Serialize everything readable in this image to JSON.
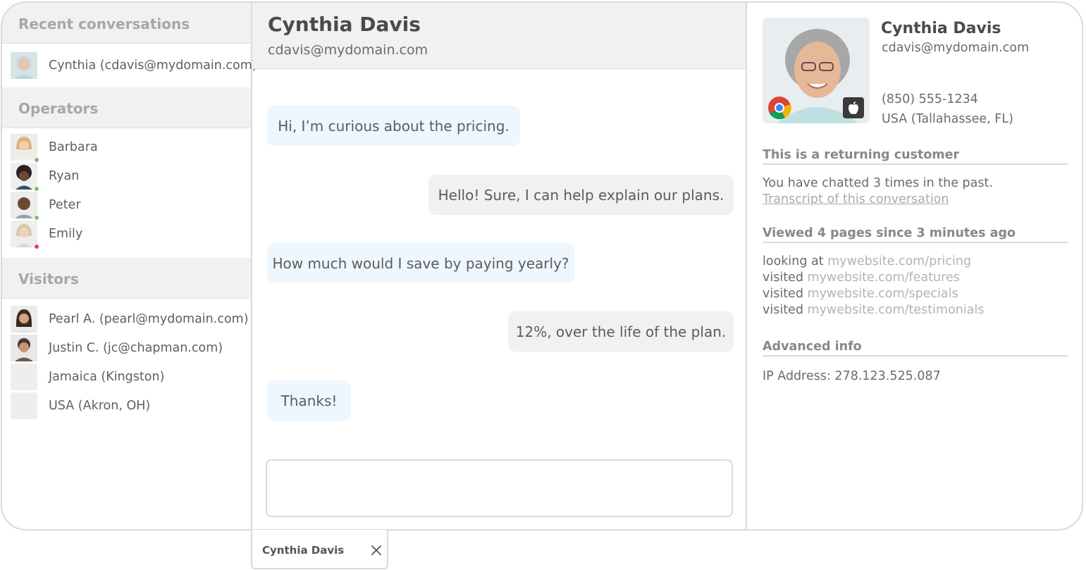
{
  "sidebar": {
    "recent_title": "Recent conversations",
    "recent": [
      {
        "label": "Cynthia (cdavis@mydomain.com)"
      }
    ],
    "operators_title": "Operators",
    "operators": [
      {
        "label": "Barbara",
        "status": "online",
        "status_color": "#7ac16b"
      },
      {
        "label": "Ryan",
        "status": "online",
        "status_color": "#7ac16b"
      },
      {
        "label": "Peter",
        "status": "online",
        "status_color": "#7ac16b"
      },
      {
        "label": "Emily",
        "status": "busy",
        "status_color": "#e8424b"
      }
    ],
    "visitors_title": "Visitors",
    "visitors": [
      {
        "label": "Pearl A. (pearl@mydomain.com)"
      },
      {
        "label": "Justin C. (jc@chapman.com)"
      },
      {
        "label": "Jamaica (Kingston)"
      },
      {
        "label": "USA (Akron, OH)"
      }
    ]
  },
  "chat": {
    "name": "Cynthia Davis",
    "email": "cdavis@mydomain.com",
    "messages": [
      {
        "from": "visitor",
        "text": "Hi, I’m curious about the pricing."
      },
      {
        "from": "operator",
        "text": "Hello! Sure, I can help explain our plans."
      },
      {
        "from": "visitor",
        "text": "How much would I save by paying yearly?"
      },
      {
        "from": "operator",
        "text": "12%, over the life of the plan."
      },
      {
        "from": "visitor",
        "text": "Thanks!"
      }
    ],
    "compose_value": ""
  },
  "info": {
    "name": "Cynthia Davis",
    "email": "cdavis@mydomain.com",
    "phone": "(850) 555-1234",
    "location": "USA (Tallahassee, FL)",
    "returning_title": "This is a returning customer",
    "returning_text": "You have chatted 3 times in the past.",
    "transcript_link": "Transcript of this conversation",
    "pages_title": "Viewed 4 pages since 3 minutes ago",
    "pages": [
      {
        "verb": "looking at",
        "url": "mywebsite.com/pricing"
      },
      {
        "verb": "visited",
        "url": "mywebsite.com/features"
      },
      {
        "verb": "visited",
        "url": "mywebsite.com/specials"
      },
      {
        "verb": "visited",
        "url": "mywebsite.com/testimonials"
      }
    ],
    "advanced_title": "Advanced info",
    "ip_text": "IP Address: 278.123.525.087",
    "browser_icon": "chrome-icon",
    "os_icon": "apple-icon"
  },
  "tab": {
    "name": "Cynthia Davis",
    "close_icon": "close-icon"
  },
  "colors": {
    "border": "#dcd9da",
    "header_bg": "#f2f0f0",
    "visitor_bubble": "#eef6fe",
    "operator_bubble": "#f2f0f0"
  }
}
